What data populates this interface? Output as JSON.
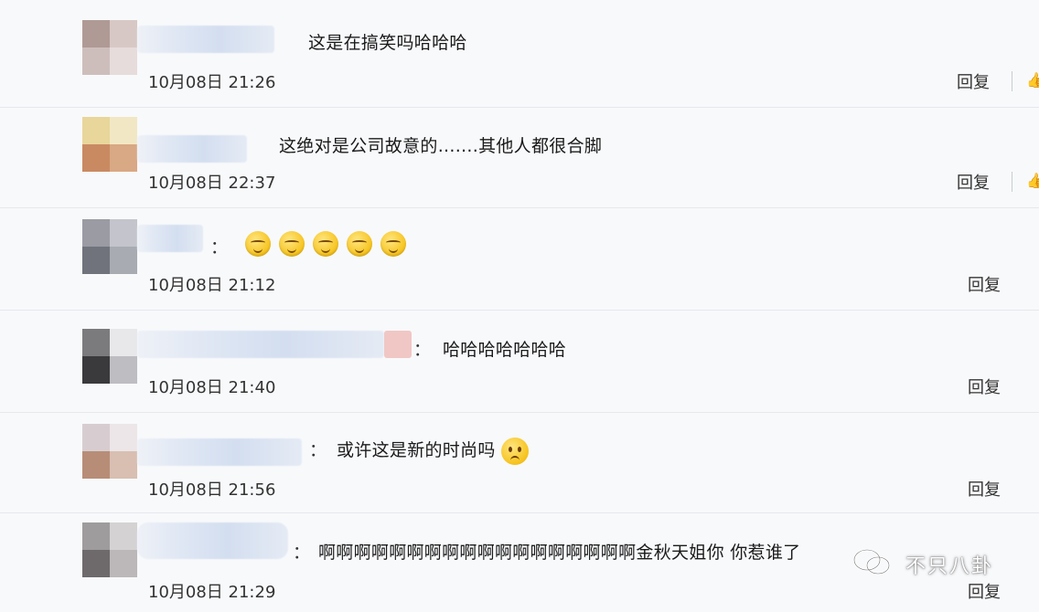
{
  "comments": [
    {
      "text": "这是在搞笑吗哈哈哈",
      "date": "10月08日 21:26",
      "reply": "回复"
    },
    {
      "text": "这绝对是公司故意的.......其他人都很合脚",
      "date": "10月08日 22:37",
      "reply": "回复"
    },
    {
      "colon": "：",
      "text": "",
      "date": "10月08日 21:12",
      "reply": "回复"
    },
    {
      "colon": "：",
      "text": "哈哈哈哈哈哈哈",
      "date": "10月08日 21:40",
      "reply": "回复"
    },
    {
      "colon": "：",
      "text": "或许这是新的时尚吗",
      "date": "10月08日 21:56",
      "reply": "回复"
    },
    {
      "colon": "：",
      "text": "啊啊啊啊啊啊啊啊啊啊啊啊啊啊啊啊啊啊金秋天姐你 你惹谁了",
      "date": "10月08日 21:29",
      "reply": "回复"
    }
  ],
  "watermark": "不只八卦",
  "icons": {
    "like": "thumbs-up-icon",
    "emoji_grin": "grin-emoji-icon",
    "emoji_worried": "worried-emoji-icon"
  }
}
